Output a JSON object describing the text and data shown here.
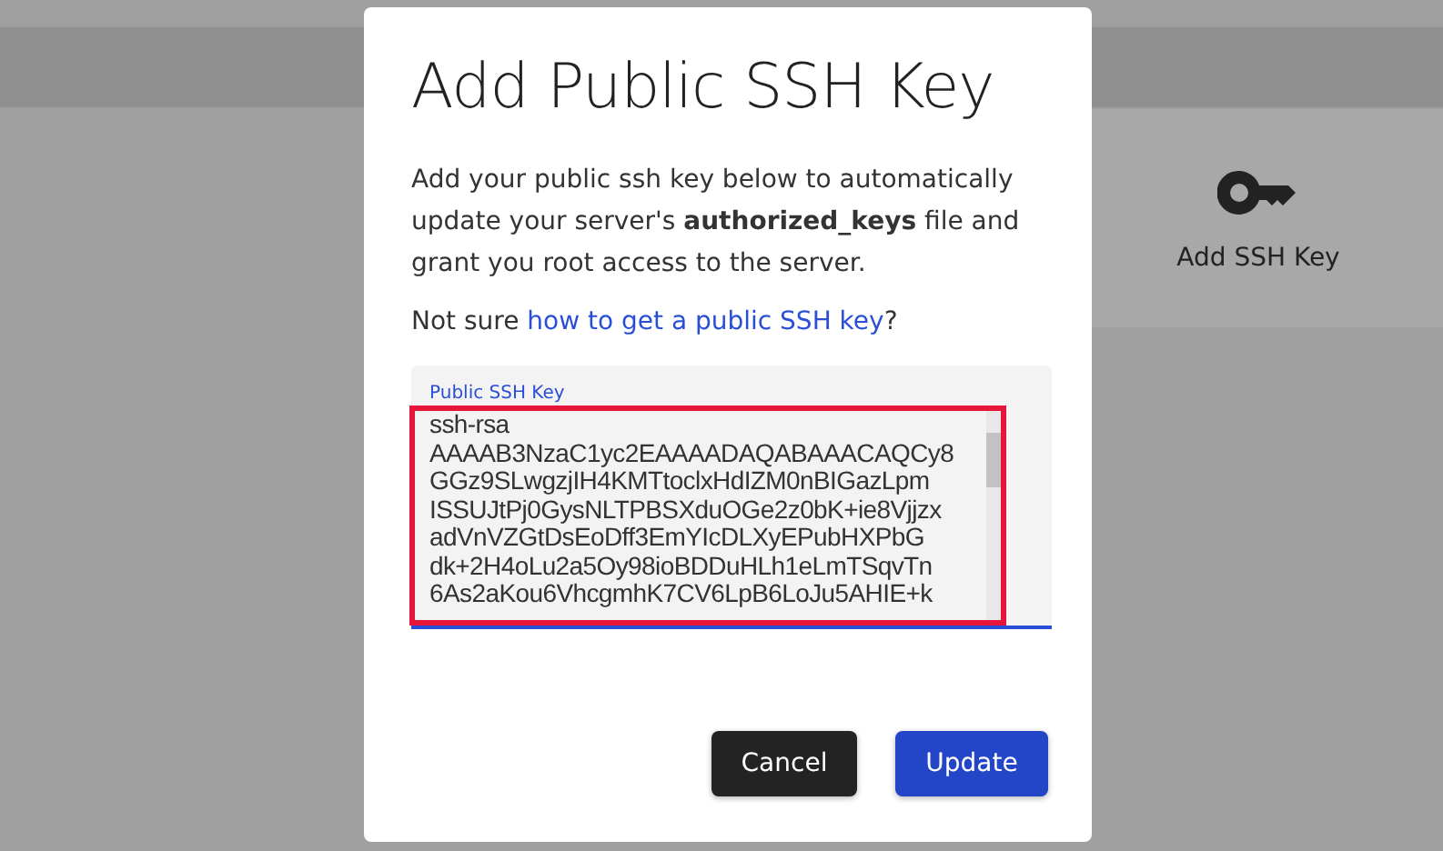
{
  "background": {
    "card_label": "Add SSH Key"
  },
  "dialog": {
    "title": "Add Public SSH Key",
    "description": "Add your public ssh key below to automatically update your server's **authorized_keys** file and grant you root access to the server.",
    "help_prefix": "Not sure ",
    "help_link": "how to get a public SSH key",
    "help_suffix": "?",
    "field": {
      "label": "Public SSH Key",
      "value": "ssh-rsa\nAAAAB3NzaC1yc2EAAAADAQABAAACAQCy8\nGGz9SLwgzjIH4KMTtoclxHdIZM0nBIGazLpm\nISSUJtPj0GysNLTPBSXduOGe2z0bK+ie8Vjjzx\nadVnVZGtDsEoDff3EmYIcDLXyEPubHXPbG\ndk+2H4oLu2a5Oy98ioBDDuHLh1eLmTSqvTn\n6As2aKou6VhcgmhK7CV6LpB6LoJu5AHIE+k",
      "highlighted": true
    },
    "buttons": [
      {
        "label": "Cancel",
        "kind": "secondary"
      },
      {
        "label": "Update",
        "kind": "primary"
      }
    ]
  }
}
